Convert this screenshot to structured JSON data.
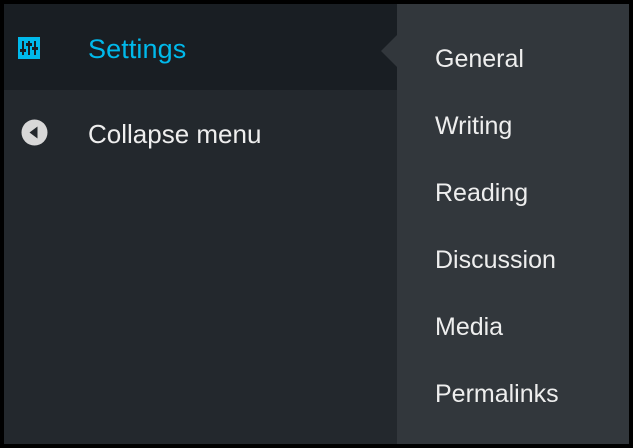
{
  "menu": {
    "settings_label": "Settings",
    "settings_icon": "settings-sliders-icon",
    "collapse_label": "Collapse menu",
    "collapse_icon": "collapse-arrow-icon"
  },
  "submenu": {
    "items": [
      {
        "label": "General"
      },
      {
        "label": "Writing"
      },
      {
        "label": "Reading"
      },
      {
        "label": "Discussion"
      },
      {
        "label": "Media"
      },
      {
        "label": "Permalinks"
      }
    ]
  },
  "colors": {
    "sidebar_bg": "#23282d",
    "active_bg": "#191e23",
    "submenu_bg": "#32373c",
    "accent": "#00b9eb",
    "text": "#eeeeee"
  }
}
